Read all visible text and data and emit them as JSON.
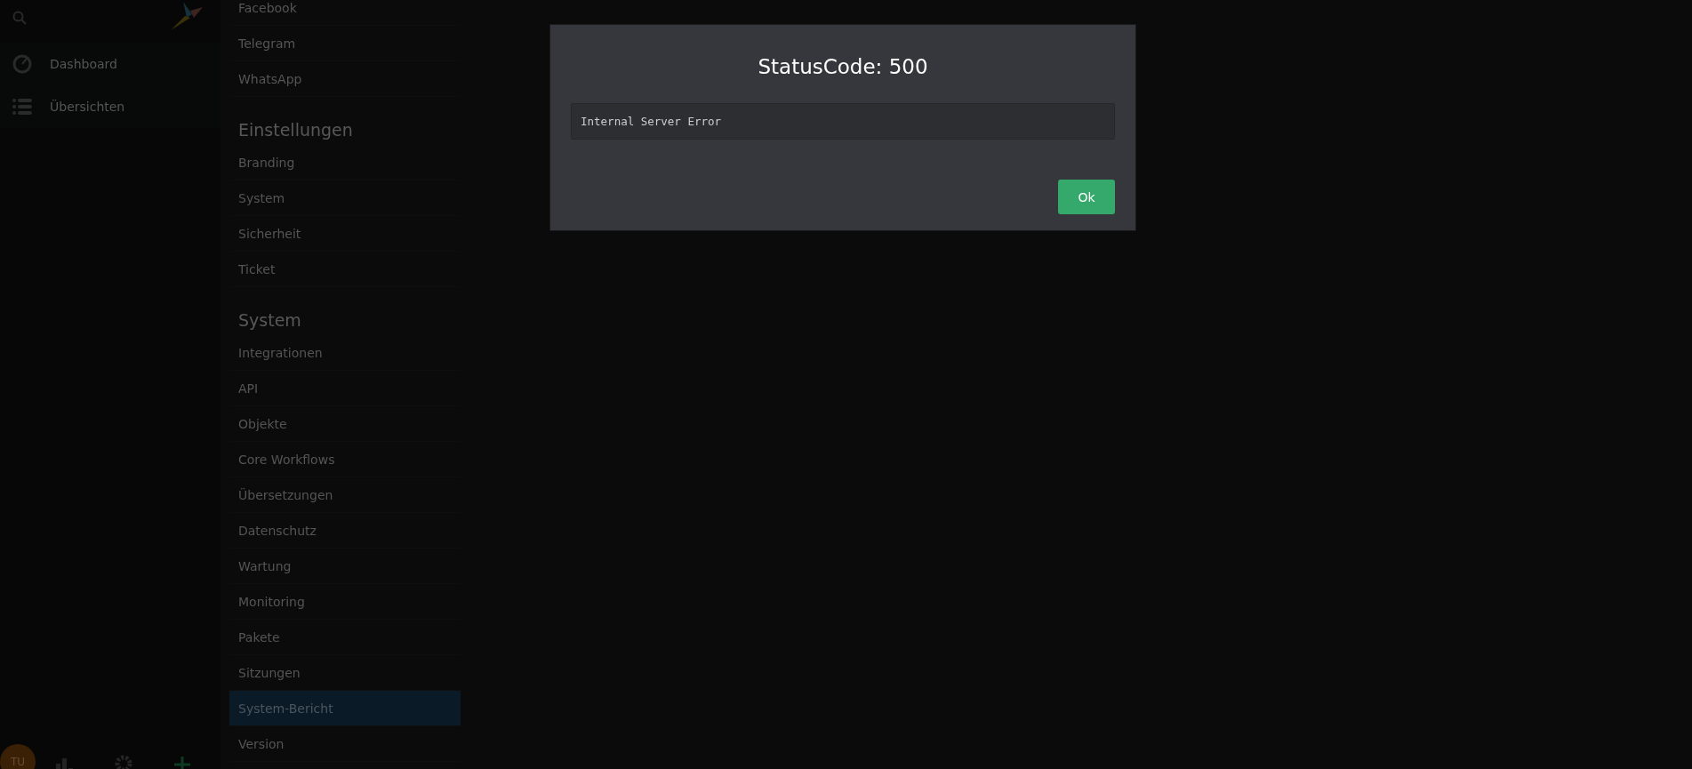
{
  "sidebar": {
    "items": [
      {
        "label": "Dashboard",
        "kind": "dashboard",
        "selected": false
      },
      {
        "label": "Übersichten",
        "kind": "list",
        "selected": false
      }
    ],
    "avatar": "TU"
  },
  "nav": {
    "sections": [
      {
        "items": [
          {
            "label": "Facebook",
            "selected": false
          },
          {
            "label": "Telegram",
            "selected": false
          },
          {
            "label": "WhatsApp",
            "selected": false
          }
        ]
      },
      {
        "heading": "Einstellungen",
        "items": [
          {
            "label": "Branding",
            "selected": false
          },
          {
            "label": "System",
            "selected": false
          },
          {
            "label": "Sicherheit",
            "selected": false
          },
          {
            "label": "Ticket",
            "selected": false
          }
        ]
      },
      {
        "heading": "System",
        "items": [
          {
            "label": "Integrationen",
            "selected": false
          },
          {
            "label": "API",
            "selected": false
          },
          {
            "label": "Objekte",
            "selected": false
          },
          {
            "label": "Core Workflows",
            "selected": false
          },
          {
            "label": "Übersetzungen",
            "selected": false
          },
          {
            "label": "Datenschutz",
            "selected": false
          },
          {
            "label": "Wartung",
            "selected": false
          },
          {
            "label": "Monitoring",
            "selected": false
          },
          {
            "label": "Pakete",
            "selected": false
          },
          {
            "label": "Sitzungen",
            "selected": false
          },
          {
            "label": "System-Bericht",
            "selected": true
          },
          {
            "label": "Version",
            "selected": false
          }
        ]
      }
    ]
  },
  "dialog": {
    "title": "StatusCode: 500",
    "message": "Internal Server Error",
    "button": "Ok"
  }
}
